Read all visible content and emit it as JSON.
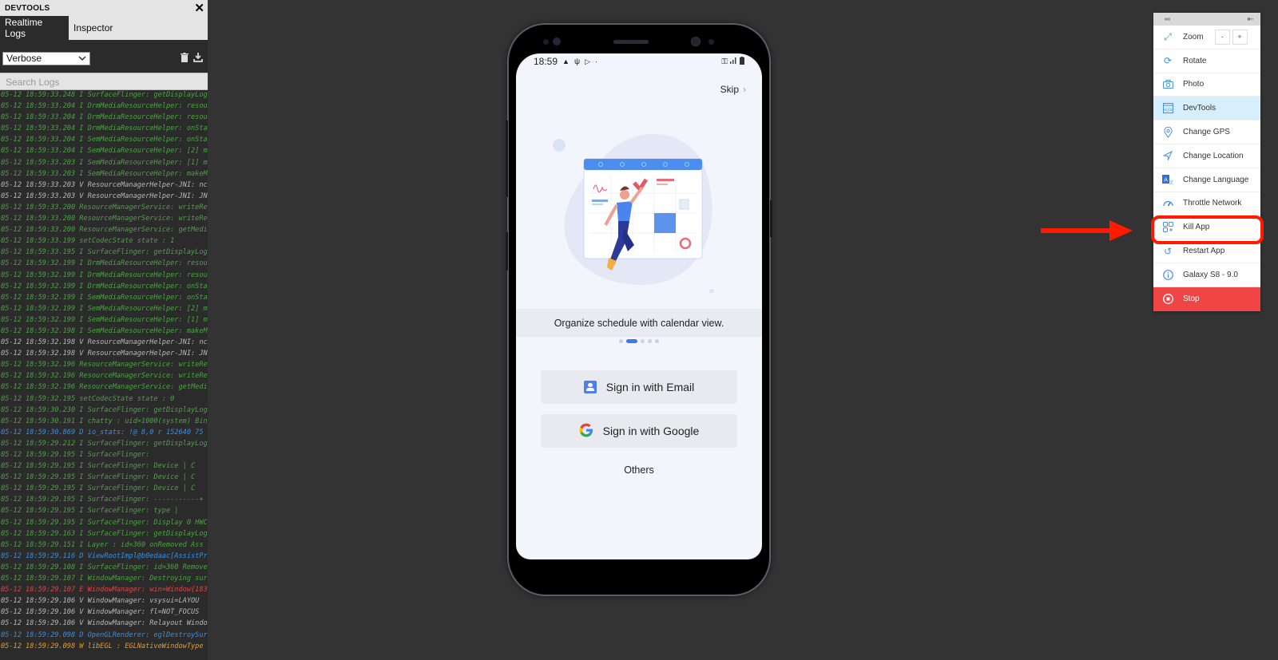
{
  "devtools": {
    "title": "DEVTOOLS",
    "close_icon": "close-icon",
    "tabs": [
      {
        "label": "Realtime Logs",
        "active": true
      },
      {
        "label": "Inspector",
        "active": false
      }
    ],
    "level_select": "Verbose",
    "search_placeholder": "Search Logs",
    "logs": [
      {
        "level": "I",
        "text": "05-12 18:59:33.248 I SurfaceFlinger: getDisplayLog"
      },
      {
        "level": "I",
        "text": "05-12 18:59:33.204 I DrmMediaResourceHelper: resou"
      },
      {
        "level": "I",
        "text": "05-12 18:59:33.204 I DrmMediaResourceHelper: resou"
      },
      {
        "level": "I",
        "text": "05-12 18:59:33.204 I DrmMediaResourceHelper: onSta"
      },
      {
        "level": "I",
        "text": "05-12 18:59:33.204 I SemMediaResourceHelper: onSta"
      },
      {
        "level": "I",
        "text": "05-12 18:59:33.204 I SemMediaResourceHelper: [2] m"
      },
      {
        "level": "I",
        "text": "05-12 18:59:33.203 I SemMediaResourceHelper: [1] m"
      },
      {
        "level": "I",
        "text": "05-12 18:59:33.203 I SemMediaResourceHelper: makeM"
      },
      {
        "level": "V",
        "text": "05-12 18:59:33.203 V ResourceManagerHelper-JNI: nc"
      },
      {
        "level": "V",
        "text": "05-12 18:59:33.203 V ResourceManagerHelper-JNI: JN"
      },
      {
        "level": "I",
        "text": "05-12 18:59:33.200 ResourceManagerService: writeRe"
      },
      {
        "level": "I",
        "text": "05-12 18:59:33.200 ResourceManagerService: writeRe"
      },
      {
        "level": "I",
        "text": "05-12 18:59:33.200 ResourceManagerService: getMedi"
      },
      {
        "level": "I",
        "text": "05-12 18:59:33.199 setCodecState state : 1"
      },
      {
        "level": "I",
        "text": "05-12 18:59:33.195 I SurfaceFlinger: getDisplayLog"
      },
      {
        "level": "I",
        "text": "05-12 18:59:32.199 I DrmMediaResourceHelper: resou"
      },
      {
        "level": "I",
        "text": "05-12 18:59:32.199 I DrmMediaResourceHelper: resou"
      },
      {
        "level": "I",
        "text": "05-12 18:59:32.199 I DrmMediaResourceHelper: onSta"
      },
      {
        "level": "I",
        "text": "05-12 18:59:32.199 I SemMediaResourceHelper: onSta"
      },
      {
        "level": "I",
        "text": "05-12 18:59:32.199 I SemMediaResourceHelper: [2] m"
      },
      {
        "level": "I",
        "text": "05-12 18:59:32.199 I SemMediaResourceHelper: [1] m"
      },
      {
        "level": "I",
        "text": "05-12 18:59:32.198 I SemMediaResourceHelper: makeM"
      },
      {
        "level": "V",
        "text": "05-12 18:59:32.198 V ResourceManagerHelper-JNI: nc"
      },
      {
        "level": "V",
        "text": "05-12 18:59:32.198 V ResourceManagerHelper-JNI: JN"
      },
      {
        "level": "I",
        "text": "05-12 18:59:32.196 ResourceManagerService: writeRe"
      },
      {
        "level": "I",
        "text": "05-12 18:59:32.196 ResourceManagerService: writeRe"
      },
      {
        "level": "I",
        "text": "05-12 18:59:32.196 ResourceManagerService: getMedi"
      },
      {
        "level": "I",
        "text": "05-12 18:59:32.195 setCodecState state : 0"
      },
      {
        "level": "I",
        "text": "05-12 18:59:30.230 I SurfaceFlinger: getDisplayLog"
      },
      {
        "level": "I",
        "text": "05-12 18:59:30.191 I chatty  : uid=1000(system) Bin"
      },
      {
        "level": "D",
        "text": "05-12 18:59:30.869 D io_stats: !@   8,0 r 152640 75"
      },
      {
        "level": "I",
        "text": "05-12 18:59:29.212 I SurfaceFlinger: getDisplayLog"
      },
      {
        "level": "I",
        "text": "05-12 18:59:29.195 I SurfaceFlinger:"
      },
      {
        "level": "I",
        "text": "05-12 18:59:29.195 I SurfaceFlinger:     Device | C"
      },
      {
        "level": "I",
        "text": "05-12 18:59:29.195 I SurfaceFlinger:     Device | C"
      },
      {
        "level": "I",
        "text": "05-12 18:59:29.195 I SurfaceFlinger:     Device | C"
      },
      {
        "level": "I",
        "text": "05-12 18:59:29.195 I SurfaceFlinger: -----------+"
      },
      {
        "level": "I",
        "text": "05-12 18:59:29.195 I SurfaceFlinger:    type   |"
      },
      {
        "level": "I",
        "text": "05-12 18:59:29.195 I SurfaceFlinger: Display 0 HWC"
      },
      {
        "level": "I",
        "text": "05-12 18:59:29.163 I SurfaceFlinger: getDisplayLog"
      },
      {
        "level": "I",
        "text": "05-12 18:59:29.151 I Layer   : id=360 onRemoved Ass"
      },
      {
        "level": "D",
        "text": "05-12 18:59:29.116 D ViewRootImpl@b0edaac[AssistPr"
      },
      {
        "level": "I",
        "text": "05-12 18:59:29.108 I SurfaceFlinger: id=360 Remove"
      },
      {
        "level": "I",
        "text": "05-12 18:59:29.107 I WindowManager: Destroying sur"
      },
      {
        "level": "E",
        "text": "05-12 18:59:29.107 E WindowManager: win=Window{183"
      },
      {
        "level": "V",
        "text": "05-12 18:59:29.106 V WindowManager:   vsysui=LAYOU"
      },
      {
        "level": "V",
        "text": "05-12 18:59:29.106 V WindowManager:   fl=NOT_FOCUS"
      },
      {
        "level": "V",
        "text": "05-12 18:59:29.106 V WindowManager: Relayout Windo"
      },
      {
        "level": "D",
        "text": "05-12 18:59:29.098 D OpenGLRenderer: eglDestroySur"
      },
      {
        "level": "W",
        "text": "05-12 18:59:29.098 W libEGL  : EGLNativeWindowType"
      }
    ]
  },
  "phone": {
    "status_time": "18:59",
    "skip_label": "Skip",
    "caption": "Organize schedule with calendar view.",
    "pager": {
      "total": 5,
      "active_index": 1
    },
    "email_button": "Sign in with Email",
    "google_button": "Sign in with Google",
    "others_label": "Others"
  },
  "toolbar": {
    "items": [
      {
        "id": "zoom",
        "label": "Zoom",
        "icon": "expand-icon",
        "minus": "-",
        "plus": "+"
      },
      {
        "id": "rotate",
        "label": "Rotate",
        "icon": "rotate-icon"
      },
      {
        "id": "photo",
        "label": "Photo",
        "icon": "camera-icon"
      },
      {
        "id": "devtools",
        "label": "DevTools",
        "icon": "code-icon",
        "active": true
      },
      {
        "id": "gps",
        "label": "Change GPS",
        "icon": "location-pin-icon"
      },
      {
        "id": "location",
        "label": "Change Location",
        "icon": "navigation-icon"
      },
      {
        "id": "language",
        "label": "Change Language",
        "icon": "language-icon"
      },
      {
        "id": "network",
        "label": "Throttle Network",
        "icon": "gauge-icon"
      },
      {
        "id": "kill",
        "label": "Kill App",
        "icon": "apps-icon",
        "highlighted": true
      },
      {
        "id": "restart",
        "label": "Restart App",
        "icon": "restart-icon"
      },
      {
        "id": "device",
        "label": "Galaxy S8 - 9.0",
        "icon": "info-icon"
      },
      {
        "id": "stop",
        "label": "Stop",
        "icon": "stop-icon"
      }
    ]
  },
  "annotation": {
    "color": "#ff1a00",
    "target": "Kill App"
  }
}
